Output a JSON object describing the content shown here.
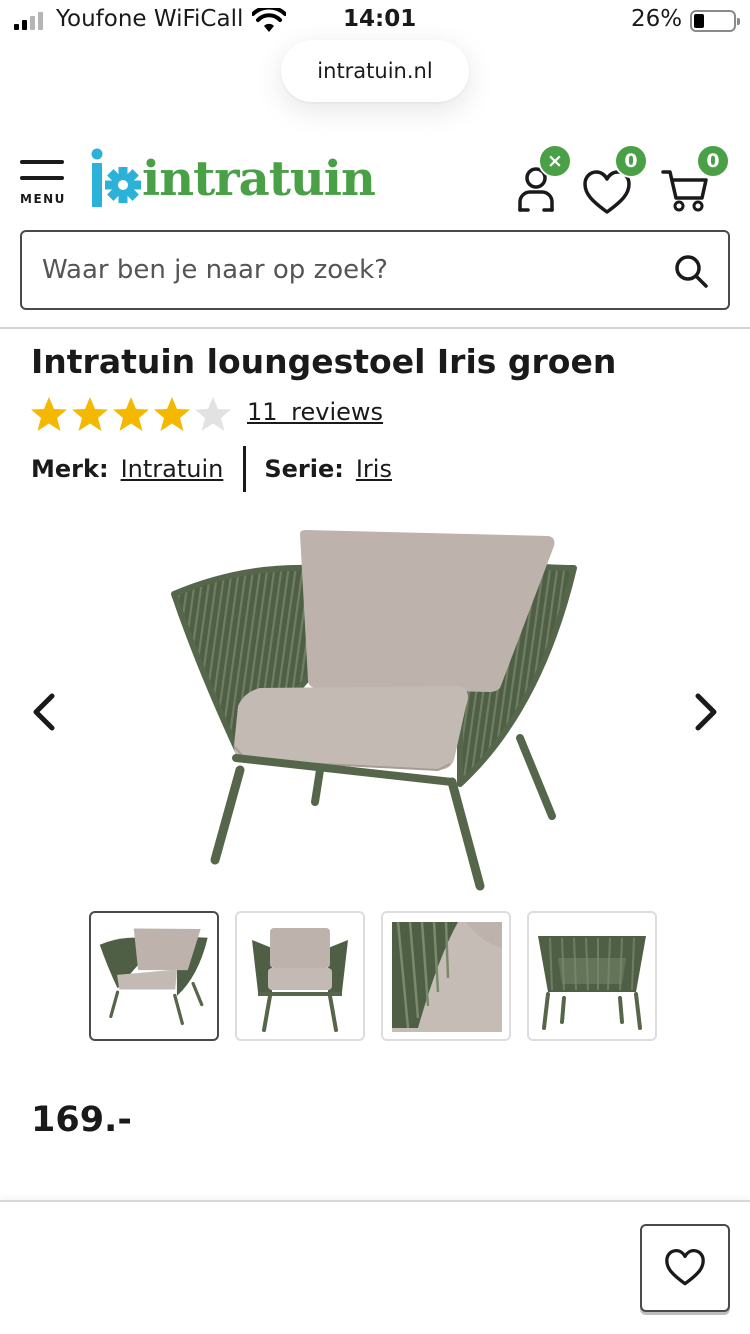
{
  "status_bar": {
    "carrier": "Youfone WiFiCall",
    "time": "14:01",
    "battery_percent": "26%",
    "icons": [
      "signal-icon",
      "wifi-icon",
      "battery-icon"
    ]
  },
  "browser": {
    "url": "intratuin.nl"
  },
  "header": {
    "menu_label": "MENU",
    "logo_text": "intratuin",
    "account_badge": "×",
    "wishlist_badge": "0",
    "cart_badge": "0"
  },
  "search": {
    "placeholder": "Waar ben je naar op zoek?"
  },
  "product": {
    "title": "Intratuin loungestoel Iris groen",
    "rating": 4,
    "rating_max": 5,
    "reviews": "11 reviews",
    "brand_label": "Merk:",
    "brand": "Intratuin",
    "series_label": "Serie:",
    "series": "Iris",
    "price": "169.-"
  },
  "gallery": {
    "thumbnail_count": 4,
    "active_index": 0
  },
  "colors": {
    "brand_green": "#49a046",
    "brand_blue": "#2cb1d9",
    "star": "#f5b800",
    "star_empty": "#e2e2e2",
    "chair_frame": "#55664a",
    "cushion": "#bdb2ac"
  }
}
